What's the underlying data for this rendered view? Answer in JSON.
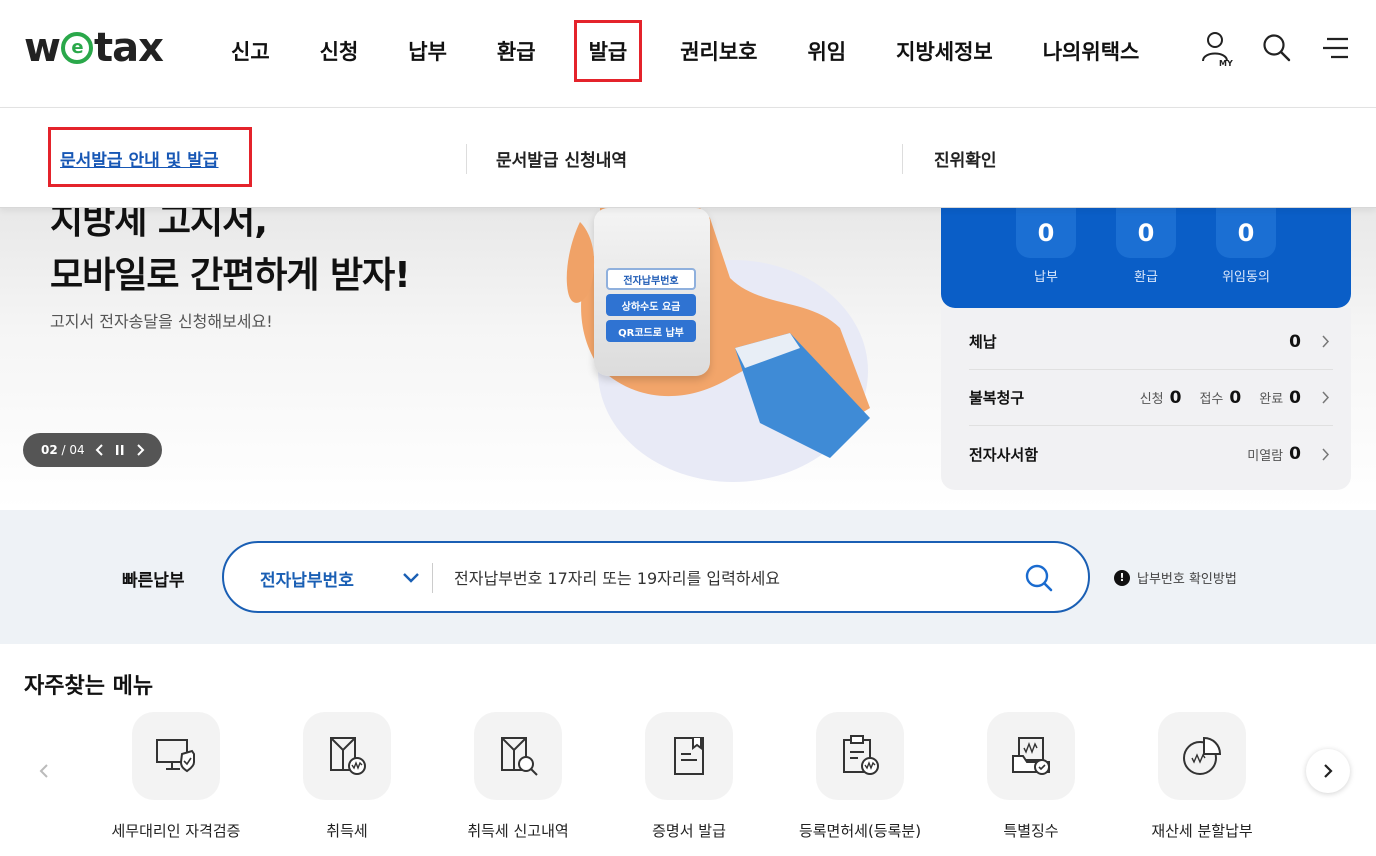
{
  "header": {
    "logo": {
      "part1": "w",
      "part2": "e",
      "part3": "tax"
    },
    "nav": [
      {
        "label": "신고"
      },
      {
        "label": "신청"
      },
      {
        "label": "납부"
      },
      {
        "label": "환급"
      },
      {
        "label": "발급",
        "active": true
      },
      {
        "label": "권리보호"
      },
      {
        "label": "위임"
      },
      {
        "label": "지방세정보"
      },
      {
        "label": "나의위택스"
      }
    ],
    "my_label": "MY"
  },
  "submenu": {
    "items": [
      {
        "label": "문서발급 안내 및 발급",
        "active": true
      },
      {
        "label": "문서발급 신청내역"
      },
      {
        "label": "진위확인"
      }
    ]
  },
  "hero": {
    "title_line1": "지방세 고지서,",
    "title_line2": "모바일로 간편하게 받자!",
    "subtitle": "고지서 전자송달을 신청해보세요!",
    "slide_current": "02",
    "slide_sep": " / ",
    "slide_total": "04",
    "phone_buttons": [
      "전자납부번호",
      "상하수도 요금",
      "QR코드로 납부"
    ]
  },
  "status": {
    "counts": [
      {
        "value": "0",
        "label": "납부"
      },
      {
        "value": "0",
        "label": "환급"
      },
      {
        "value": "0",
        "label": "위임동의"
      }
    ],
    "rows": {
      "arrears": {
        "label": "체납",
        "value": "0"
      },
      "appeal": {
        "label": "불복청구",
        "s1": "신청",
        "v1": "0",
        "s2": "접수",
        "v2": "0",
        "s3": "완료",
        "v3": "0"
      },
      "mailbox": {
        "label": "전자사서함",
        "s1": "미열람",
        "v1": "0"
      }
    }
  },
  "quickpay": {
    "label": "빠른납부",
    "select_value": "전자납부번호",
    "placeholder": "전자납부번호 17자리 또는 19자리를 입력하세요",
    "help": "납부번호 확인방법",
    "help_icon": "!"
  },
  "favorites": {
    "title": "자주찾는 메뉴",
    "items": [
      {
        "label": "세무대리인 자격검증",
        "icon": "monitor-shield-icon"
      },
      {
        "label": "취득세",
        "icon": "document-won-icon"
      },
      {
        "label": "취득세 신고내역",
        "icon": "document-search-icon"
      },
      {
        "label": "증명서 발급",
        "icon": "certificate-icon"
      },
      {
        "label": "등록면허세(등록분)",
        "icon": "clipboard-won-icon"
      },
      {
        "label": "특별징수",
        "icon": "folder-check-icon"
      },
      {
        "label": "재산세 분할납부",
        "icon": "pie-chart-won-icon"
      }
    ]
  },
  "colors": {
    "brand_blue": "#0a5ec7",
    "highlight_red": "#e4232b",
    "logo_green": "#2aa84a"
  }
}
